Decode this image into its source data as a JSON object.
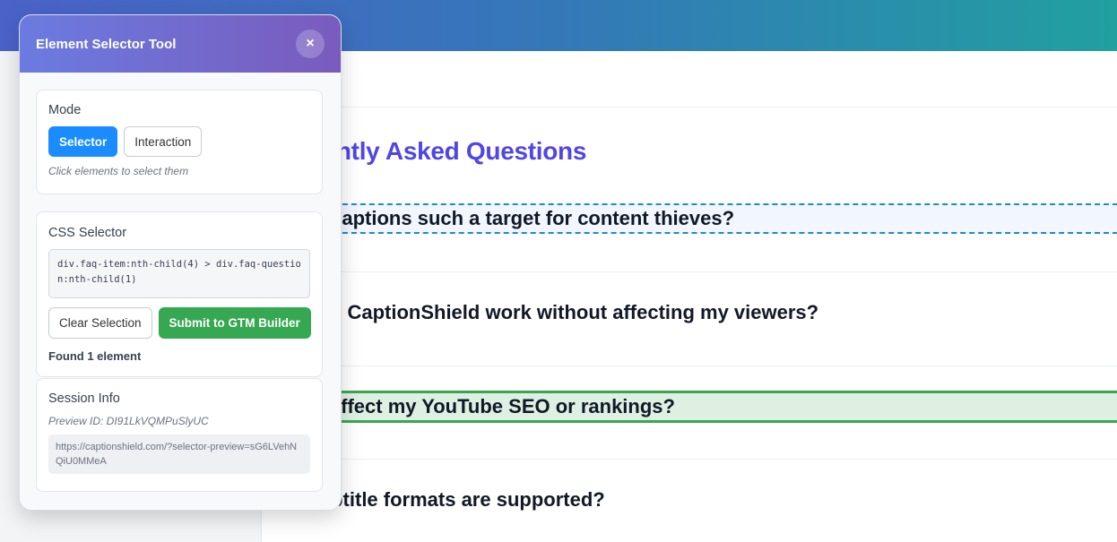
{
  "page": {
    "faq_title": "quently Asked Questions",
    "questions": [
      "are captions such a target for content thieves?",
      "does CaptionShield work without affecting my viewers?",
      "his affect my YouTube SEO or rankings?",
      "t subtitle formats are supported?"
    ]
  },
  "panel": {
    "title": "Element Selector Tool",
    "close_label": "×",
    "mode": {
      "title": "Mode",
      "selector_label": "Selector",
      "interaction_label": "Interaction",
      "active": "Selector",
      "hint": "Click elements to select them"
    },
    "css": {
      "title": "CSS Selector",
      "value": "div.faq-item:nth-child(4) > div.faq-question:nth-child(1)",
      "clear_label": "Clear Selection",
      "submit_label": "Submit to GTM Builder",
      "found_text": "Found 1 element"
    },
    "session": {
      "title": "Session Info",
      "preview_id": "Preview ID: DI91LkVQMPuSlyUC",
      "url": "https://captionshield.com/?selector-preview=sG6LVehNQiU0MMeA"
    }
  },
  "colors": {
    "header_gradient_start": "#6b7be0",
    "header_gradient_end": "#7a5bbd",
    "primary": "#1a8cff",
    "success": "#36a852",
    "faq_title": "#4f46e5",
    "hover_outline": "#1d8ad6"
  },
  "icons": {
    "close": "close-icon"
  }
}
